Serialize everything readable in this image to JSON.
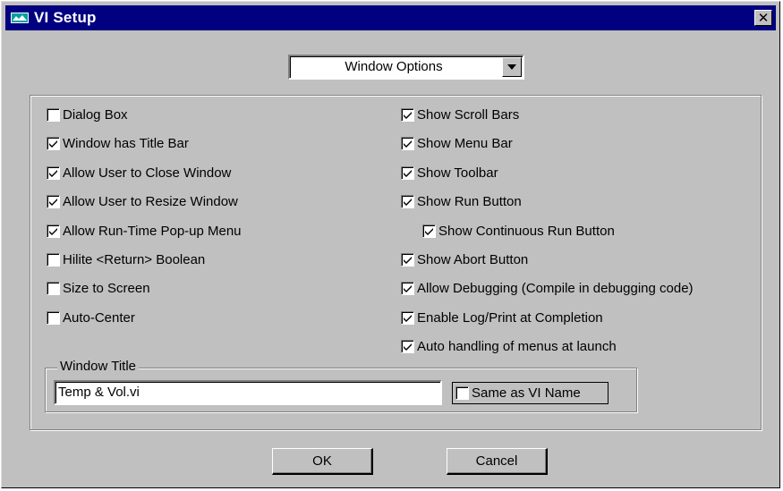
{
  "window": {
    "title": "VI Setup",
    "close_glyph": "✕",
    "icon": "labview-app-icon"
  },
  "mode_select": {
    "value": "Window Options"
  },
  "left_options": [
    {
      "label": "Dialog Box",
      "checked": false
    },
    {
      "label": "Window has Title Bar",
      "checked": true
    },
    {
      "label": "Allow User to Close Window",
      "checked": true
    },
    {
      "label": "Allow User to Resize Window",
      "checked": true
    },
    {
      "label": "Allow Run-Time Pop-up Menu",
      "checked": true
    },
    {
      "label": "Hilite <Return> Boolean",
      "checked": false
    },
    {
      "label": "Size to Screen",
      "checked": false
    },
    {
      "label": "Auto-Center",
      "checked": false
    }
  ],
  "right_options": [
    {
      "label": "Show Scroll Bars",
      "checked": true
    },
    {
      "label": "Show Menu Bar",
      "checked": true
    },
    {
      "label": "Show Toolbar",
      "checked": true
    },
    {
      "label": "Show Run Button",
      "checked": true
    },
    {
      "label": "Show Continuous Run Button",
      "checked": true,
      "indented": true
    },
    {
      "label": "Show Abort Button",
      "checked": true
    },
    {
      "label": "Allow Debugging (Compile in debugging code)",
      "checked": true
    },
    {
      "label": "Enable Log/Print at Completion",
      "checked": true
    },
    {
      "label": "Auto handling of menus at launch",
      "checked": true
    }
  ],
  "window_title_group": {
    "legend": "Window Title",
    "value": "Temp & Vol.vi",
    "same_as_label": "Same as VI Name",
    "same_as_checked": false
  },
  "buttons": {
    "ok": "OK",
    "cancel": "Cancel"
  }
}
